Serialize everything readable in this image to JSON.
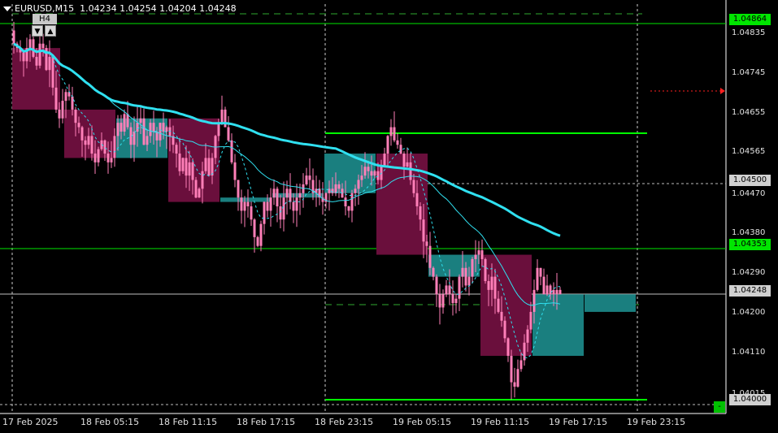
{
  "header": {
    "symbol_timeframe": "EURUSD,M15",
    "ohlc": "1.04234 1.04254 1.04204 1.04248",
    "higher_tf_label": "H4"
  },
  "colors": {
    "background": "#000000",
    "bull": "#ff7fb8",
    "bear": "#ff7fb8",
    "h4_bull": "#1a7f7f",
    "h4_bear": "#6a0f3c",
    "ma": "#30e0f0",
    "level": "#00ff00",
    "grid": "#ffffff"
  },
  "price_axis": {
    "labels": [
      "1.04835",
      "1.04745",
      "1.04655",
      "1.04565",
      "1.04470",
      "1.04380",
      "1.04290",
      "1.04200",
      "1.04110",
      "1.04015"
    ],
    "tags": [
      {
        "text": "1.04864",
        "bg": "#00e600"
      },
      {
        "text": "1.04500",
        "bg": "#d0d0d0"
      },
      {
        "text": "1.04353",
        "bg": "#00e600"
      },
      {
        "text": "1.04248",
        "bg": "#d0d0d0"
      },
      {
        "text": "1.04000",
        "bg": "#d0d0d0"
      }
    ]
  },
  "time_axis": [
    "17 Feb 2025",
    "18 Feb 05:15",
    "18 Feb 11:15",
    "18 Feb 17:15",
    "18 Feb 23:15",
    "19 Feb 05:15",
    "19 Feb 11:15",
    "19 Feb 17:15",
    "19 Feb 23:15"
  ],
  "chart_data": {
    "type": "candlestick",
    "symbol": "EURUSD",
    "timeframe": "M15",
    "ylim": [
      1.0398,
      1.049
    ],
    "levels": [
      1.04864,
      1.04617,
      1.04353,
      1.04025
    ],
    "h4_candles": [
      {
        "start": 0,
        "end": 14,
        "open": 1.048,
        "close": 1.0466
      },
      {
        "start": 16,
        "end": 31,
        "open": 1.0466,
        "close": 1.0455
      },
      {
        "start": 32,
        "end": 47,
        "open": 1.0455,
        "close": 1.0464
      },
      {
        "start": 48,
        "end": 63,
        "open": 1.0464,
        "close": 1.0445
      },
      {
        "start": 64,
        "end": 79,
        "open": 1.0445,
        "close": 1.0446
      },
      {
        "start": 80,
        "end": 95,
        "open": 1.0446,
        "close": 1.0447
      },
      {
        "start": 96,
        "end": 111,
        "open": 1.0447,
        "close": 1.0456
      },
      {
        "start": 112,
        "end": 127,
        "open": 1.0456,
        "close": 1.0433
      },
      {
        "start": 128,
        "end": 143,
        "open": 1.0428,
        "close": 1.0433
      },
      {
        "start": 144,
        "end": 159,
        "open": 1.0433,
        "close": 1.041
      },
      {
        "start": 160,
        "end": 175,
        "open": 1.041,
        "close": 1.0424
      },
      {
        "start": 176,
        "end": 191,
        "open": 1.042,
        "close": 1.0424
      }
    ],
    "close_series": [
      1.0481,
      1.048,
      1.0479,
      1.0477,
      1.048,
      1.0482,
      1.0478,
      1.0476,
      1.0481,
      1.048,
      1.0475,
      1.0478,
      1.0471,
      1.0466,
      1.0464,
      1.0468,
      1.047,
      1.0469,
      1.0466,
      1.0463,
      1.0462,
      1.0459,
      1.0458,
      1.046,
      1.0456,
      1.0454,
      1.0457,
      1.0459,
      1.0456,
      1.0454,
      1.0455,
      1.046,
      1.0463,
      1.0461,
      1.0465,
      1.0462,
      1.0458,
      1.0461,
      1.0463,
      1.0464,
      1.0458,
      1.046,
      1.0463,
      1.0461,
      1.0459,
      1.0463,
      1.0461,
      1.0462,
      1.046,
      1.0458,
      1.0456,
      1.0452,
      1.0455,
      1.0451,
      1.0454,
      1.045,
      1.0446,
      1.0448,
      1.0452,
      1.0455,
      1.0451,
      1.0455,
      1.046,
      1.0463,
      1.0466,
      1.0462,
      1.0459,
      1.0454,
      1.045,
      1.0446,
      1.0443,
      1.0445,
      1.0444,
      1.0441,
      1.0437,
      1.0435,
      1.044,
      1.0445,
      1.0443,
      1.0446,
      1.0448,
      1.0444,
      1.0441,
      1.0446,
      1.0448,
      1.0445,
      1.0443,
      1.0446,
      1.0447,
      1.0449,
      1.0451,
      1.045,
      1.0447,
      1.0448,
      1.0446,
      1.0445,
      1.0447,
      1.0448,
      1.0447,
      1.0449,
      1.0448,
      1.0446,
      1.0444,
      1.0443,
      1.0447,
      1.0448,
      1.045,
      1.0451,
      1.0453,
      1.0452,
      1.0451,
      1.0452,
      1.045,
      1.0453,
      1.0456,
      1.046,
      1.0462,
      1.0459,
      1.0458,
      1.0456,
      1.0453,
      1.0454,
      1.045,
      1.0447,
      1.0444,
      1.0441,
      1.0436,
      1.0435,
      1.043,
      1.0428,
      1.0424,
      1.0421,
      1.0424,
      1.0426,
      1.0424,
      1.0422,
      1.0423,
      1.0428,
      1.043,
      1.0426,
      1.0428,
      1.0432,
      1.0433,
      1.0434,
      1.0432,
      1.0427,
      1.0425,
      1.0428,
      1.0423,
      1.042,
      1.0418,
      1.0414,
      1.041,
      1.0404,
      1.0403,
      1.0407,
      1.0409,
      1.0413,
      1.0416,
      1.042,
      1.0425,
      1.043,
      1.0428,
      1.0424,
      1.0426,
      1.0424,
      1.0425,
      1.0424,
      1.0425
    ]
  }
}
